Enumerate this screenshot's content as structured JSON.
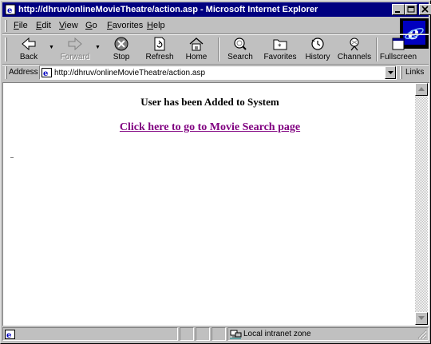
{
  "window": {
    "title": "http://dhruv/onlineMovieTheatre/action.asp - Microsoft Internet Explorer"
  },
  "menu": [
    "File",
    "Edit",
    "View",
    "Go",
    "Favorites",
    "Help"
  ],
  "toolbar": {
    "back": "Back",
    "forward": "Forward",
    "stop": "Stop",
    "refresh": "Refresh",
    "home": "Home",
    "search": "Search",
    "favorites": "Favorites",
    "history": "History",
    "channels": "Channels",
    "fullscreen": "Fullscreen"
  },
  "address": {
    "label": "Address",
    "url": "http://dhruv/onlineMovieTheatre/action.asp",
    "links_label": "Links"
  },
  "page": {
    "message": "User has been Added to System",
    "link_text": "Click here to go to Movie Search page"
  },
  "status": {
    "zone": "Local intranet zone"
  },
  "colors": {
    "titlebar": "#000080",
    "chrome": "#c0c0c0",
    "visited_link": "#800080"
  }
}
